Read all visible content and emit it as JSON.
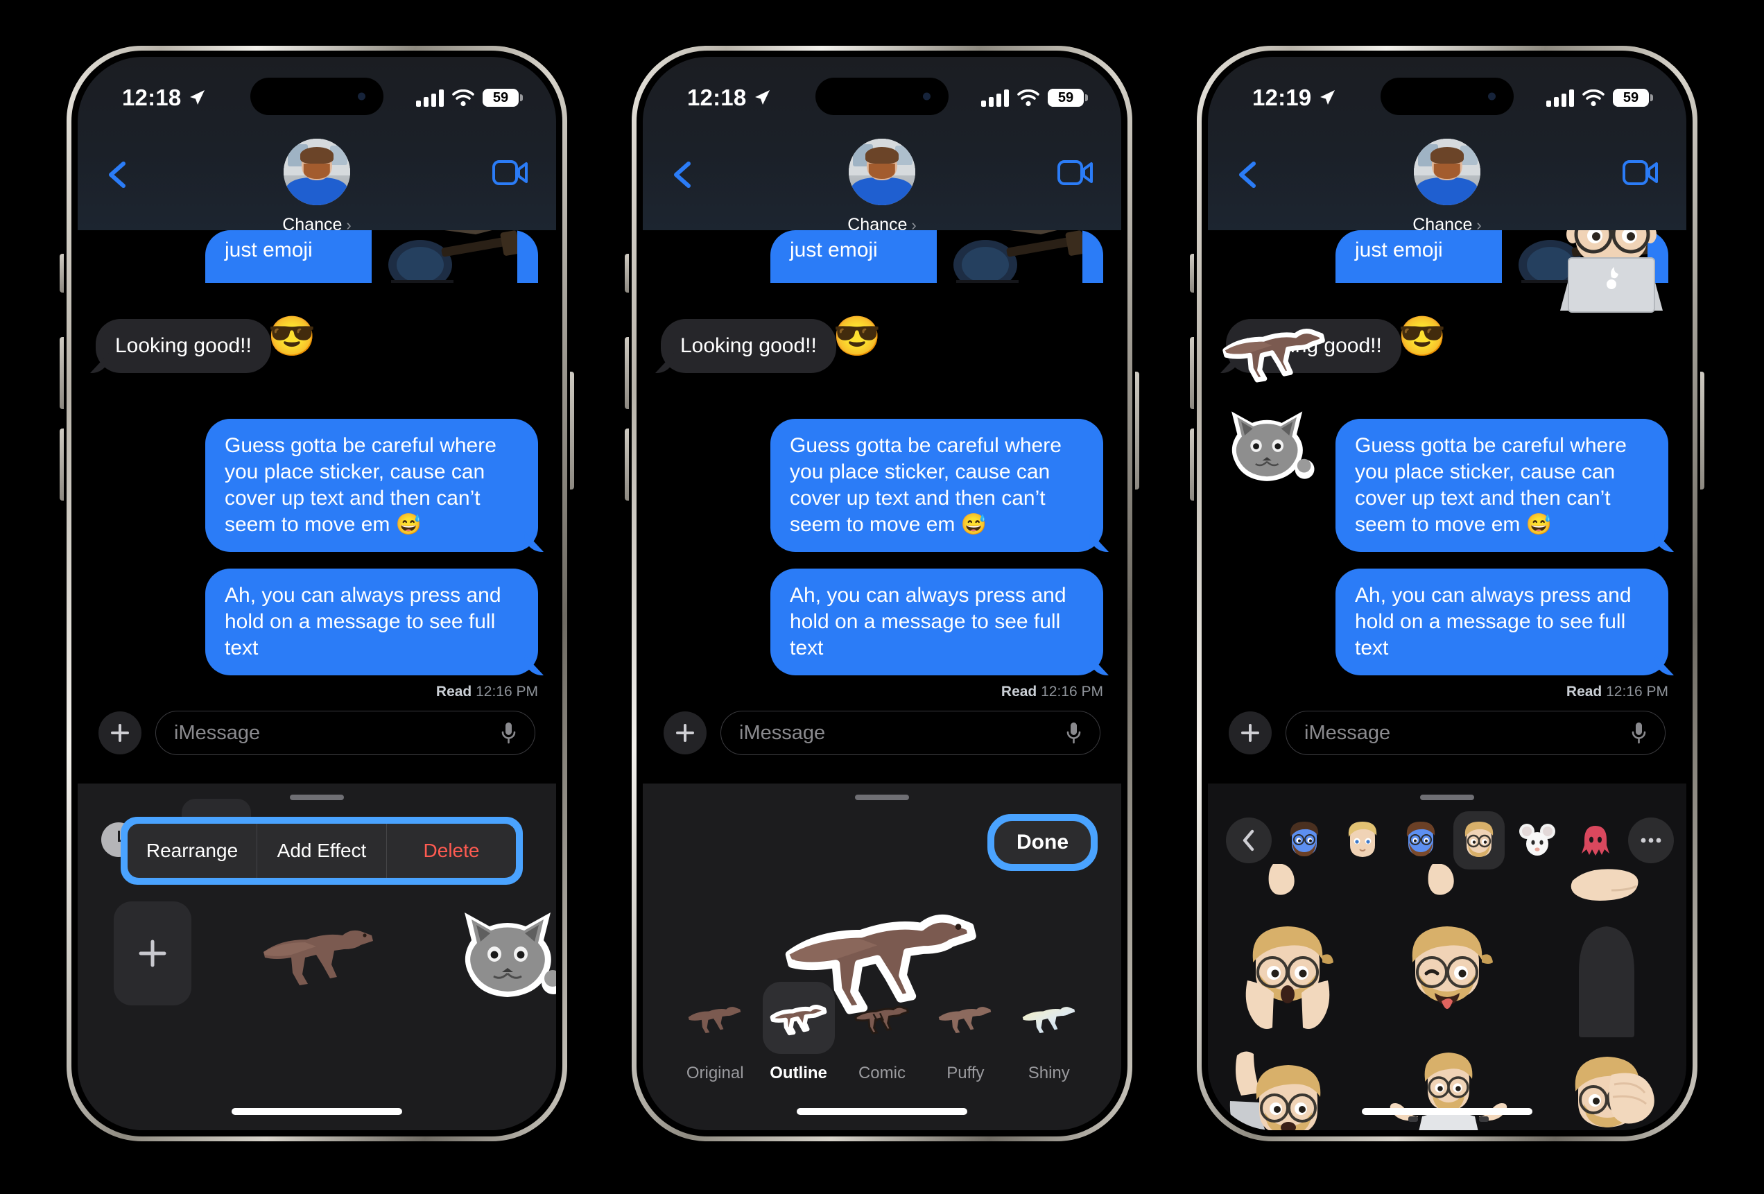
{
  "app": {
    "name": "Messages",
    "platform": "iOS"
  },
  "phones": [
    {
      "id": "phone-1",
      "status": {
        "time": "12:18",
        "battery": "59",
        "location_icon": "location-arrow-icon",
        "signal_icon": "cellular-bars-icon",
        "wifi_icon": "wifi-icon"
      },
      "nav": {
        "back_icon": "chevron-left-icon",
        "contact_name": "Chance",
        "disclosure": "›",
        "facetime_icon": "video-camera-icon"
      },
      "messages": [
        {
          "id": "m0",
          "side": "outgoing",
          "text": "just emoji",
          "has_photo": true
        },
        {
          "id": "m1",
          "side": "incoming",
          "text": "Looking good!!",
          "reaction_emoji": "😎"
        },
        {
          "id": "m2",
          "side": "outgoing",
          "text": "Guess gotta be careful where you place sticker, cause can cover up text and then can’t seem to move em 😅"
        },
        {
          "id": "m3",
          "side": "outgoing",
          "text": "Ah, you can always press and hold on a message to see full text"
        }
      ],
      "receipt": {
        "label": "Read",
        "time": "12:16 PM"
      },
      "input": {
        "plus_icon": "plus-icon",
        "placeholder": "iMessage",
        "mic_icon": "microphone-icon"
      },
      "drawer": {
        "recents_icon": "clock-icon",
        "context_menu": {
          "highlighted": true,
          "items": [
            "Rearrange",
            "Add Effect",
            "Delete"
          ],
          "destructive_index": 2
        },
        "add_button_icon": "plus-icon",
        "stickers": [
          "dinosaur-sticker",
          "cat-sticker"
        ]
      }
    },
    {
      "id": "phone-2",
      "status": {
        "time": "12:18",
        "battery": "59",
        "location_icon": "location-arrow-icon",
        "signal_icon": "cellular-bars-icon",
        "wifi_icon": "wifi-icon"
      },
      "nav": {
        "back_icon": "chevron-left-icon",
        "contact_name": "Chance",
        "disclosure": "›",
        "facetime_icon": "video-camera-icon"
      },
      "messages": [
        {
          "id": "m0",
          "side": "outgoing",
          "text": "just emoji",
          "has_photo": true
        },
        {
          "id": "m1",
          "side": "incoming",
          "text": "Looking good!!",
          "reaction_emoji": "😎"
        },
        {
          "id": "m2",
          "side": "outgoing",
          "text": "Guess gotta be careful where you place sticker, cause can cover up text and then can’t seem to move em 😅"
        },
        {
          "id": "m3",
          "side": "outgoing",
          "text": "Ah, you can always press and hold on a message to see full text"
        }
      ],
      "receipt": {
        "label": "Read",
        "time": "12:16 PM"
      },
      "input": {
        "plus_icon": "plus-icon",
        "placeholder": "iMessage",
        "mic_icon": "microphone-icon"
      },
      "editor": {
        "done_label": "Done",
        "done_highlighted": true,
        "preview_sticker": "dinosaur-sticker-outline",
        "effects": [
          {
            "label": "Original",
            "selected": false
          },
          {
            "label": "Outline",
            "selected": true
          },
          {
            "label": "Comic",
            "selected": false
          },
          {
            "label": "Puffy",
            "selected": false
          },
          {
            "label": "Shiny",
            "selected": false
          }
        ]
      }
    },
    {
      "id": "phone-3",
      "status": {
        "time": "12:19",
        "battery": "59",
        "location_icon": "location-arrow-icon",
        "signal_icon": "cellular-bars-icon",
        "wifi_icon": "wifi-icon"
      },
      "nav": {
        "back_icon": "chevron-left-icon",
        "contact_name": "Chance",
        "disclosure": "›",
        "facetime_icon": "video-camera-icon"
      },
      "messages": [
        {
          "id": "m0",
          "side": "outgoing",
          "text": "just emoji",
          "has_photo": true
        },
        {
          "id": "m1",
          "side": "incoming",
          "text": "Looking good!!",
          "reaction_emoji": "😎"
        },
        {
          "id": "m2",
          "side": "outgoing",
          "text": "Guess gotta be careful where you place sticker, cause can cover up text and then can’t seem to move em 😅"
        },
        {
          "id": "m3",
          "side": "outgoing",
          "text": "Ah, you can always press and hold on a message to see full text"
        }
      ],
      "placed_stickers": [
        "memoji-laptop-sticker",
        "dinosaur-sticker-outline",
        "cat-sticker-outline"
      ],
      "receipt": {
        "label": "Read",
        "time": "12:16 PM"
      },
      "input": {
        "plus_icon": "plus-icon",
        "placeholder": "iMessage",
        "mic_icon": "microphone-icon"
      },
      "memoji_picker": {
        "back_icon": "chevron-left-icon",
        "tabs": [
          "memoji-blue-beard",
          "memoji-blonde-kid",
          "memoji-blue-face",
          "memoji-glasses-beard",
          "memoji-mouse",
          "memoji-octopus"
        ],
        "selected_tab_index": 3,
        "more_icon": "ellipsis-icon",
        "grid_items": [
          "memoji-hand-top-left",
          "memoji-hand-top-mid",
          "memoji-point-top-right",
          "memoji-shocked",
          "memoji-tongue-wink",
          "memoji-silhouette-placeholder",
          "memoji-wave",
          "memoji-shrug",
          "memoji-facepalm"
        ]
      }
    }
  ],
  "colors": {
    "outgoing_bubble": "#2b7cf7",
    "incoming_bubble": "#26262a",
    "accent_highlight": "#4aa3ff",
    "destructive": "#ff5b51",
    "screen_bg": "#000000",
    "drawer_bg": "#1c1c1e"
  }
}
